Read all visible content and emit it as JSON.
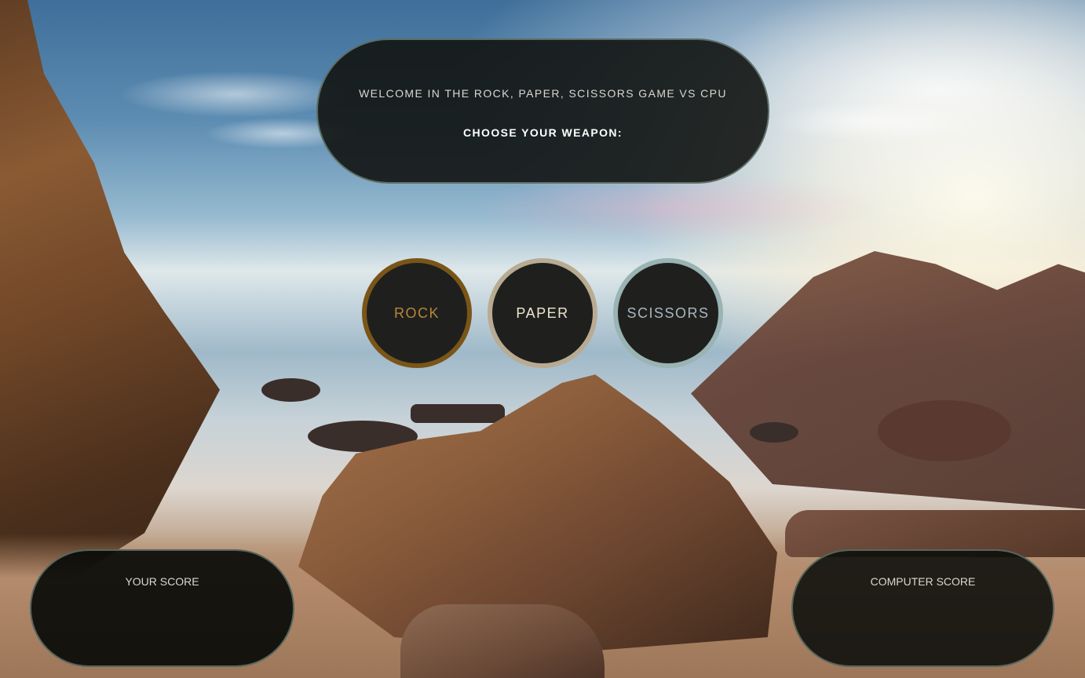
{
  "header": {
    "welcome": "WELCOME IN THE ROCK, PAPER, SCISSORS GAME VS CPU",
    "prompt": "CHOOSE YOUR WEAPON:"
  },
  "weapons": [
    {
      "label": "ROCK",
      "color": "#7a5518"
    },
    {
      "label": "PAPER",
      "color": "#b9ab92"
    },
    {
      "label": "SCISSORS",
      "color": "#9ab3b3"
    }
  ],
  "scores": {
    "player_label": "YOUR SCORE",
    "computer_label": "COMPUTER SCORE"
  },
  "background": {
    "scene": "beach-photo"
  }
}
